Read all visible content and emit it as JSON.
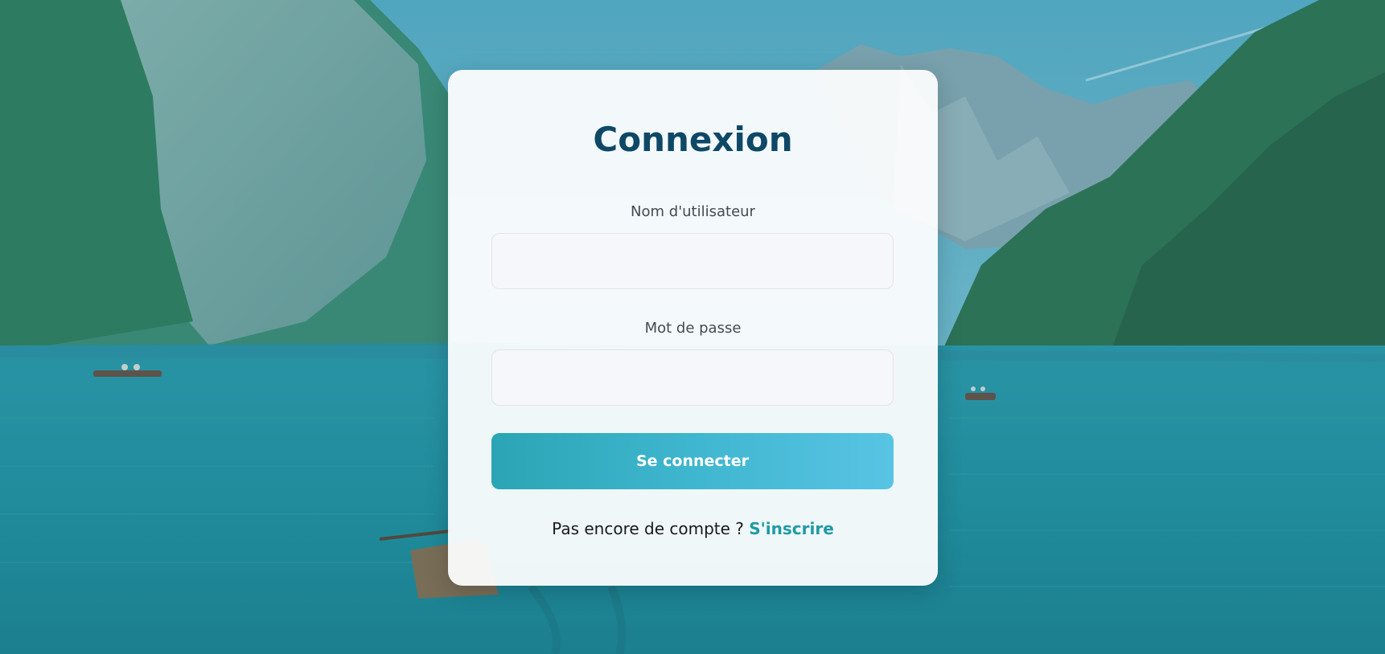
{
  "background": {
    "description_icon": "mountain-lake-photo-icon",
    "accent": "#2ba5b5"
  },
  "login": {
    "title": "Connexion",
    "username_label": "Nom d'utilisateur",
    "username_value": "",
    "password_label": "Mot de passe",
    "password_value": "",
    "submit_label": "Se connecter",
    "no_account_text": "Pas encore de compte ?",
    "signup_link": "S'inscrire"
  },
  "colors": {
    "title": "#0e4866",
    "link": "#1f9aa5",
    "button_start": "#2ba5b5",
    "button_end": "#58c4e4"
  }
}
